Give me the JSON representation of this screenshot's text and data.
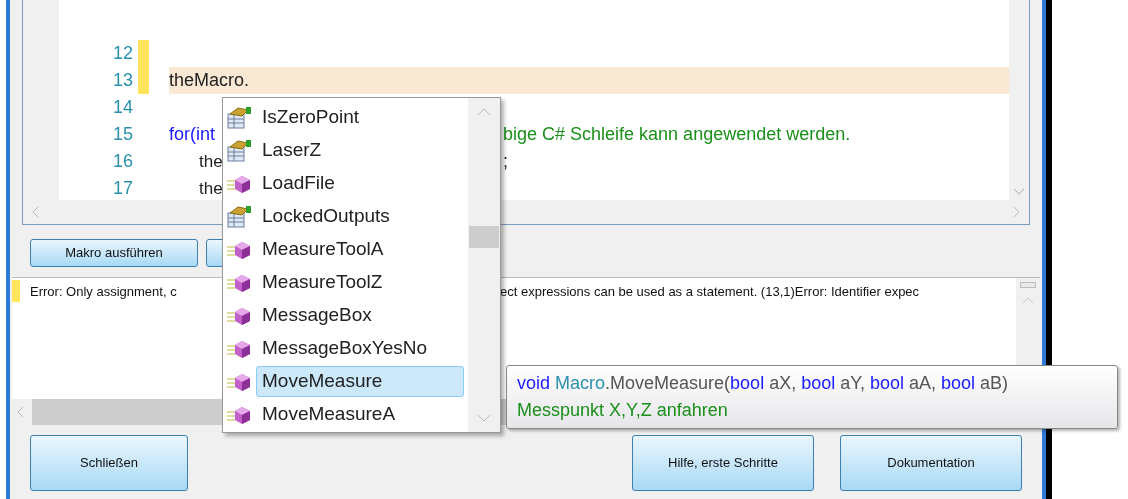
{
  "editor": {
    "lines": [
      {
        "number": "12",
        "marked": true,
        "current": false
      },
      {
        "number": "13",
        "marked": true,
        "current": true,
        "left": [
          {
            "kind": "text",
            "text": "theMacro."
          }
        ]
      },
      {
        "number": "14",
        "marked": false,
        "current": false
      },
      {
        "number": "15",
        "marked": false,
        "current": false,
        "left": [
          {
            "kind": "keyword",
            "text": "for(int"
          }
        ],
        "right": [
          {
            "kind": "comment",
            "text": "bige C# Schleife kann angewendet werden."
          }
        ]
      },
      {
        "number": "16",
        "marked": false,
        "current": false,
        "left": [
          {
            "kind": "indent",
            "text": "the"
          }
        ],
        "right": [
          {
            "kind": "text",
            "text": ";"
          }
        ]
      },
      {
        "number": "17",
        "marked": false,
        "current": false,
        "left": [
          {
            "kind": "indent",
            "text": "the"
          }
        ]
      }
    ]
  },
  "run_button": "Makro ausführen",
  "output": {
    "left": "Error: Only assignment, c",
    "right": "ect expressions can be used as a statement. (13,1)Error: Identifier expec"
  },
  "completion": {
    "items": [
      {
        "kind": "property",
        "label": "IsZeroPoint",
        "selected": false
      },
      {
        "kind": "property",
        "label": "LaserZ",
        "selected": false
      },
      {
        "kind": "method",
        "label": "LoadFile",
        "selected": false
      },
      {
        "kind": "property",
        "label": "LockedOutputs",
        "selected": false
      },
      {
        "kind": "method",
        "label": "MeasureToolA",
        "selected": false
      },
      {
        "kind": "method",
        "label": "MeasureToolZ",
        "selected": false
      },
      {
        "kind": "method",
        "label": "MessageBox",
        "selected": false
      },
      {
        "kind": "method",
        "label": "MessageBoxYesNo",
        "selected": false
      },
      {
        "kind": "method",
        "label": "MoveMeasure",
        "selected": true
      },
      {
        "kind": "method",
        "label": "MoveMeasureA",
        "selected": false
      }
    ]
  },
  "tooltip": {
    "signature": [
      {
        "kind": "keyword",
        "text": "void"
      },
      {
        "kind": "type",
        "text": " Macro"
      },
      {
        "kind": "text",
        "text": ".MoveMeasure("
      },
      {
        "kind": "keyword",
        "text": "bool"
      },
      {
        "kind": "text",
        "text": " aX, "
      },
      {
        "kind": "keyword",
        "text": "bool"
      },
      {
        "kind": "text",
        "text": " aY, "
      },
      {
        "kind": "keyword",
        "text": "bool"
      },
      {
        "kind": "text",
        "text": " aA, "
      },
      {
        "kind": "keyword",
        "text": "bool"
      },
      {
        "kind": "text",
        "text": " aB)"
      }
    ],
    "description": "Messpunkt X,Y,Z anfahren"
  },
  "buttons": [
    "Schließen",
    "Hilfe, erste Schritte",
    "Dokumentation"
  ]
}
